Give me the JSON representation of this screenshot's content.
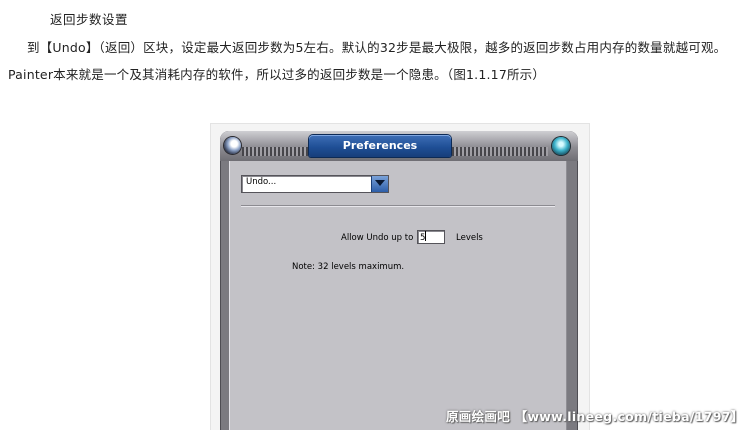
{
  "article": {
    "heading": "返回步数设置",
    "paragraph_line1": "到【Undo】（返回）区块，设定最大返回步数为5左右。默认的32步是最大极限，越多的返回步数占用内存的数量就越可观。",
    "paragraph_line2": "Painter本来就是一个及其消耗内存的软件，所以过多的返回步数是一个隐患。（图1.1.17所示）"
  },
  "dialog": {
    "title": "Preferences",
    "category_selected": "Undo...",
    "undo_label": "Allow Undo up to",
    "undo_value": "5",
    "levels_label": "Levels",
    "note": "Note: 32 levels maximum."
  },
  "watermark": "原画绘画吧 【www.lineeg.com/tieba/1797】",
  "colors": {
    "title_tab": "#1f4f96",
    "dialog_body": "#c3c2c7",
    "dialog_frame": "#7b7a80"
  }
}
